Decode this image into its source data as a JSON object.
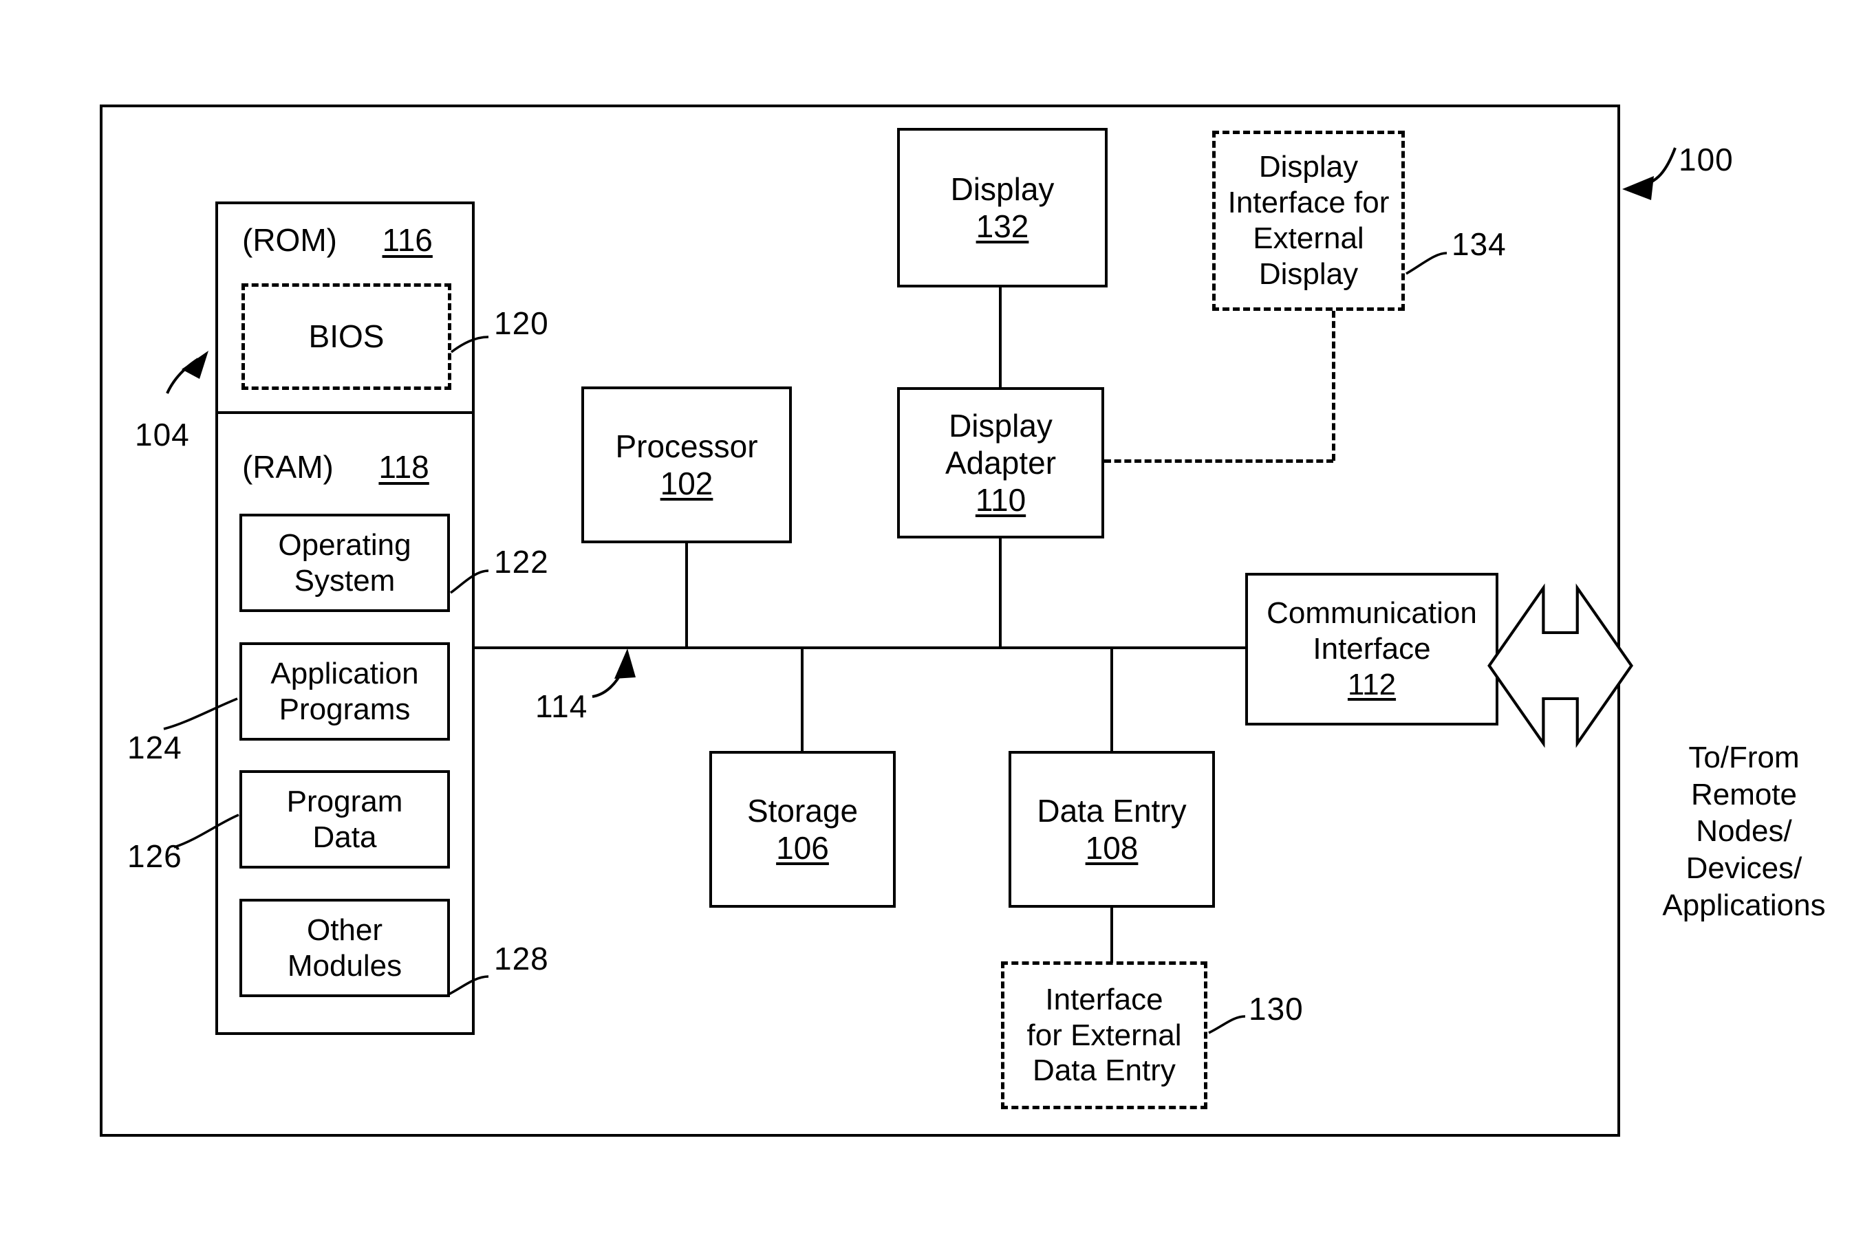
{
  "figure": {
    "system_ref": "100",
    "memory_ref": "104",
    "bus_ref": "114"
  },
  "memory": {
    "rom": {
      "label": "(ROM)",
      "ref": "116",
      "bios": {
        "label": "BIOS",
        "ref": "120"
      }
    },
    "ram": {
      "label": "(RAM)",
      "ref": "118",
      "modules": [
        {
          "label": "Operating\nSystem",
          "ref": "122"
        },
        {
          "label": "Application\nPrograms",
          "ref": "124"
        },
        {
          "label": "Program\nData",
          "ref": "126"
        },
        {
          "label": "Other\nModules",
          "ref": "128"
        }
      ]
    }
  },
  "blocks": {
    "processor": {
      "label": "Processor",
      "ref": "102"
    },
    "display": {
      "label": "Display",
      "ref": "132"
    },
    "display_adapter": {
      "label": "Display\nAdapter",
      "ref": "110"
    },
    "display_interface_external": {
      "label": "Display\nInterface for\nExternal\nDisplay",
      "ref": "134"
    },
    "communication_interface": {
      "label": "Communication\nInterface",
      "ref": "112"
    },
    "storage": {
      "label": "Storage",
      "ref": "106"
    },
    "data_entry": {
      "label": "Data Entry",
      "ref": "108"
    },
    "interface_external_data_entry": {
      "label": "Interface\nfor External\nData Entry",
      "ref": "130"
    }
  },
  "annotations": {
    "remote": "To/From\nRemote\nNodes/\nDevices/\nApplications"
  }
}
